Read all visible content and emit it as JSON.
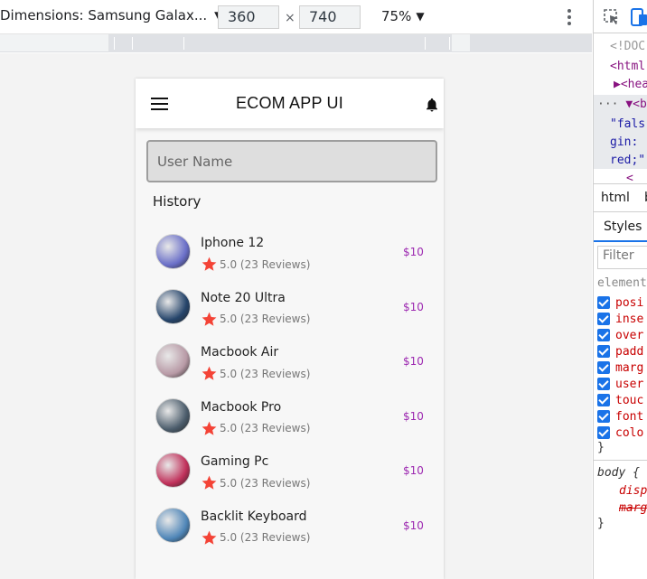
{
  "device_toolbar": {
    "dimensions_label": "Dimensions: Samsung Galax...",
    "width": "360",
    "height": "740",
    "times_sign": "×",
    "zoom": "75%"
  },
  "app": {
    "title": "ECOM APP UI",
    "search_placeholder": "User Name",
    "section_title": "History",
    "items": [
      {
        "name": "Iphone 12",
        "rating": "5.0 (23 Reviews)",
        "price": "$10",
        "thumb": "#6a6fc8"
      },
      {
        "name": "Note 20 Ultra",
        "rating": "5.0 (23 Reviews)",
        "price": "$10",
        "thumb": "#26456b"
      },
      {
        "name": "Macbook Air",
        "rating": "5.0 (23 Reviews)",
        "price": "$10",
        "thumb": "#b89aa6"
      },
      {
        "name": "Macbook Pro",
        "rating": "5.0 (23 Reviews)",
        "price": "$10",
        "thumb": "#4c5d6c"
      },
      {
        "name": "Gaming Pc",
        "rating": "5.0 (23 Reviews)",
        "price": "$10",
        "thumb": "#c0305a"
      },
      {
        "name": "Backlit Keyboard",
        "rating": "5.0 (23 Reviews)",
        "price": "$10",
        "thumb": "#4f86b8"
      }
    ]
  },
  "devtools": {
    "code_lines": [
      "<!DOC",
      "<html",
      "▶<hea",
      "▼<bod",
      "\"fals",
      "gin: ",
      "red;\"",
      "<"
    ],
    "tab_html": "html",
    "tab_b": "b",
    "styles_tab": "Styles",
    "filter_placeholder": "Filter",
    "element_style_label": "element",
    "props": [
      "posi",
      "inse",
      "over",
      "padd",
      "marg",
      "user",
      "touc",
      "font",
      "colo"
    ],
    "close_brace": "}",
    "body_rule": "body {",
    "body_props": [
      "disp",
      "marg"
    ],
    "close_brace_2": "}"
  },
  "colors": {
    "accent_price": "#9c27b0",
    "star": "#f44336",
    "devtools_blue": "#1a73e8"
  }
}
